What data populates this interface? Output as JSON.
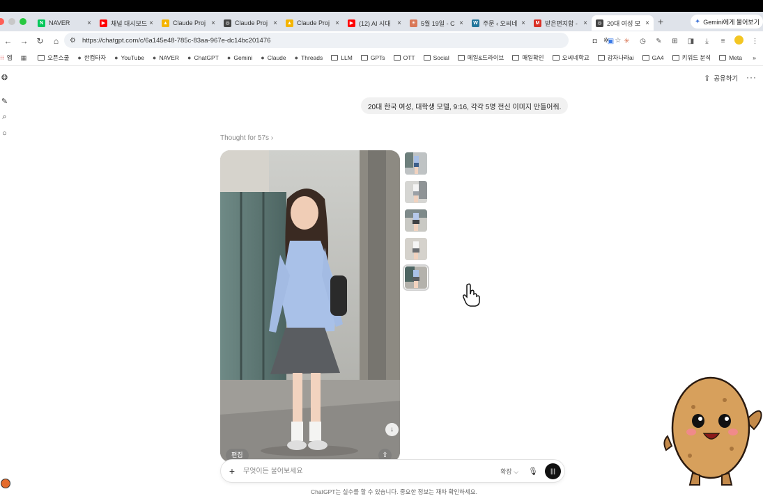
{
  "browser": {
    "tabs": [
      {
        "label": "NAVER",
        "fav_color": "#03c75a",
        "fav_text": "N"
      },
      {
        "label": "채널 대시보드",
        "fav_color": "#ff0000",
        "fav_text": "▶"
      },
      {
        "label": "Claude Proj",
        "fav_color": "#f4b400",
        "fav_text": "▲"
      },
      {
        "label": "Claude Proj",
        "fav_color": "#444444",
        "fav_text": "◎"
      },
      {
        "label": "Claude Proj",
        "fav_color": "#f4b400",
        "fav_text": "▲"
      },
      {
        "label": "(12) AI 시대",
        "fav_color": "#ff0000",
        "fav_text": "▶"
      },
      {
        "label": "5월 19일 - C",
        "fav_color": "#d97757",
        "fav_text": "✳"
      },
      {
        "label": "주문 ‹ 오씨네",
        "fav_color": "#21759b",
        "fav_text": "W"
      },
      {
        "label": "받은편지함 -",
        "fav_color": "#d93025",
        "fav_text": "M"
      },
      {
        "label": "20대 여성 모",
        "fav_color": "#444444",
        "fav_text": "◎",
        "active": true
      }
    ],
    "gemini_button": "Gemini에게 물어보기",
    "url": "https://chatgpt.com/c/6a145e48-785c-83aa-967e-dc14bc201476",
    "bookmarks": [
      {
        "label": "앱",
        "type": "apps"
      },
      {
        "label": "",
        "type": "grid"
      },
      {
        "label": "오픈스쿨",
        "type": "folder"
      },
      {
        "label": "한컴타자",
        "type": "site"
      },
      {
        "label": "YouTube",
        "type": "site"
      },
      {
        "label": "NAVER",
        "type": "site"
      },
      {
        "label": "ChatGPT",
        "type": "site"
      },
      {
        "label": "Gemini",
        "type": "site"
      },
      {
        "label": "Claude",
        "type": "site"
      },
      {
        "label": "Threads",
        "type": "site"
      },
      {
        "label": "LLM",
        "type": "folder"
      },
      {
        "label": "GPTs",
        "type": "folder"
      },
      {
        "label": "OTT",
        "type": "folder"
      },
      {
        "label": "Social",
        "type": "folder"
      },
      {
        "label": "메일&드라이브",
        "type": "folder"
      },
      {
        "label": "매일확인",
        "type": "folder"
      },
      {
        "label": "오씨네학교",
        "type": "folder"
      },
      {
        "label": "감자나라ai",
        "type": "folder"
      },
      {
        "label": "GA4",
        "type": "folder"
      },
      {
        "label": "키워드 분석",
        "type": "folder"
      },
      {
        "label": "Meta",
        "type": "folder"
      }
    ],
    "bookmarks_overflow": "»"
  },
  "chat": {
    "share_label": "공유하기",
    "more_label": "···",
    "user_message": "20대 한국 여성, 대학생 모델, 9:16, 각각 5명 전신 이미지 만들어줘.",
    "thought_label": "Thought for 57s ›",
    "edit_label": "편집",
    "composer_placeholder": "무엇이든 물어보세요",
    "expand_label": "확장 ⌵",
    "disclaimer": "ChatGPT는 실수를 할 수 있습니다. 중요한 정보는 재차 확인하세요."
  },
  "colors": {
    "tabstrip": "#dfe3ea",
    "url_bg": "#eef1f5",
    "bubble": "#f1f1f1",
    "voice_btn": "#111111"
  }
}
